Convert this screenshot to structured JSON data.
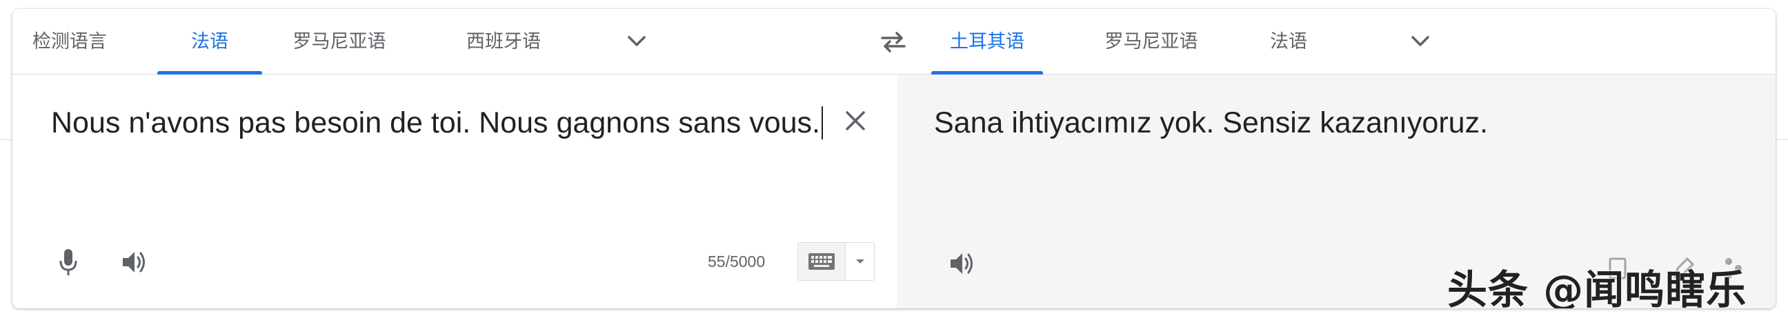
{
  "source": {
    "tabs": [
      {
        "label": "检测语言",
        "active": false
      },
      {
        "label": "法语",
        "active": true
      },
      {
        "label": "罗马尼亚语",
        "active": false
      },
      {
        "label": "西班牙语",
        "active": false
      }
    ],
    "text": "Nous n'avons pas besoin de toi. Nous gagnons sans vous.",
    "char_count": "55/5000",
    "icons": [
      "chevron-down-icon",
      "close-icon",
      "microphone-icon",
      "speaker-icon",
      "keyboard-icon",
      "caret-down-icon"
    ]
  },
  "target": {
    "tabs": [
      {
        "label": "土耳其语",
        "active": true
      },
      {
        "label": "罗马尼亚语",
        "active": false
      },
      {
        "label": "法语",
        "active": false
      }
    ],
    "text": "Sana ihtiyacımız yok. Sensiz kazanıyoruz.",
    "icons": [
      "chevron-down-icon",
      "speaker-icon"
    ]
  },
  "swap_icon": "swap-languages-icon",
  "watermark": "头条 @闻鸣瞎乐",
  "colors": {
    "accent": "#1a73e8",
    "tab_text": "#5f6368",
    "body_text": "#202124",
    "target_background": "#f5f5f5",
    "card_border": "#e0e0e0"
  }
}
